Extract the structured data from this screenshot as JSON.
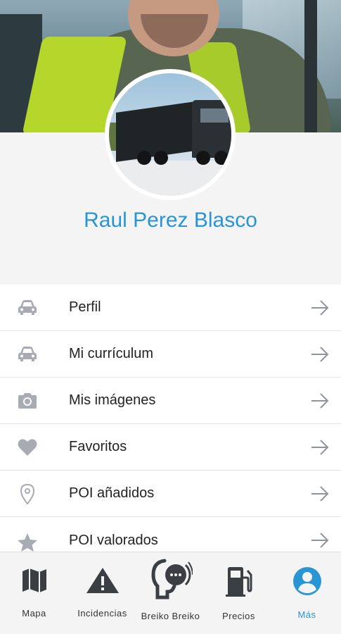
{
  "profile": {
    "name": "Raul Perez Blasco"
  },
  "menu": [
    {
      "label": "Perfil",
      "icon": "car-icon"
    },
    {
      "label": "Mi currículum",
      "icon": "car-icon"
    },
    {
      "label": "Mis imágenes",
      "icon": "camera-icon"
    },
    {
      "label": "Favoritos",
      "icon": "heart-icon"
    },
    {
      "label": "POI añadidos",
      "icon": "map-pin-icon"
    },
    {
      "label": "POI valorados",
      "icon": "star-icon"
    }
  ],
  "tabs": [
    {
      "label": "Mapa",
      "icon": "map-icon"
    },
    {
      "label": "Incidencias",
      "icon": "warning-icon"
    },
    {
      "label": "Breiko Breiko",
      "icon": "voice-chat-icon"
    },
    {
      "label": "Precios",
      "icon": "fuel-pump-icon"
    },
    {
      "label": "Más",
      "icon": "account-icon",
      "active": true
    }
  ],
  "colors": {
    "accent": "#2a95d4",
    "icon_gray": "#a8abb4",
    "tab_icon": "#3b3f44"
  }
}
